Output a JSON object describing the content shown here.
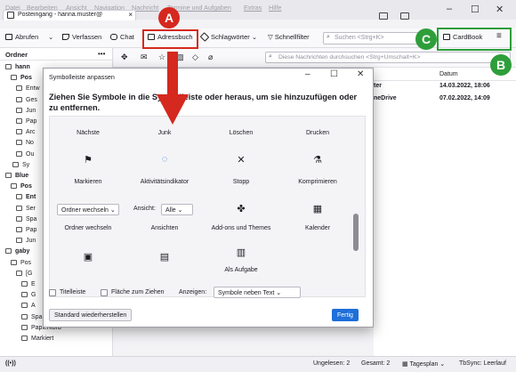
{
  "menu": [
    "Datei",
    "Bearbeiten",
    "Ansicht",
    "Navigation",
    "Nachricht",
    "Termine und Aufgaben",
    "Extras",
    "Hilfe"
  ],
  "tab": {
    "title": "Posteingang - hanna.muster@",
    "close": "×"
  },
  "window_controls": {
    "minimize": "–",
    "maximize": "☐",
    "close": "✕"
  },
  "toolbar": {
    "fetch": "Abrufen",
    "compose": "Verfassen",
    "chat": "Chat",
    "addressbook": "Adressbuch",
    "tags": "Schlagwörter",
    "quickfilter": "Schnellfilter",
    "search_placeholder": "Suchen <Strg+K>",
    "cardbook": "CardBook",
    "menu": "≡"
  },
  "folderpane": {
    "header": "Ordner",
    "more": "•••",
    "rows": [
      {
        "label": "hann",
        "bold": true
      },
      {
        "label": "Pos",
        "bold": true
      },
      {
        "label": "Entw",
        "bold": false
      },
      {
        "label": "Ges",
        "bold": false
      },
      {
        "label": "Jun",
        "bold": false
      },
      {
        "label": "Pap",
        "bold": false
      },
      {
        "label": "Arc",
        "bold": false
      },
      {
        "label": "No",
        "bold": false
      },
      {
        "label": "Ou",
        "bold": false
      },
      {
        "label": "Sy",
        "bold": false
      },
      {
        "label": "Blue",
        "bold": true
      },
      {
        "label": "Pos",
        "bold": true
      },
      {
        "label": "Ent",
        "bold": true
      },
      {
        "label": "Ser",
        "bold": false
      },
      {
        "label": "Spa",
        "bold": false
      },
      {
        "label": "Pap",
        "bold": false
      },
      {
        "label": "Jun",
        "bold": false
      },
      {
        "label": "gaby",
        "bold": true
      },
      {
        "label": "Pos",
        "bold": false
      },
      {
        "label": "[G",
        "bold": false
      },
      {
        "label": "E",
        "bold": false
      },
      {
        "label": "G",
        "bold": false
      },
      {
        "label": "A",
        "bold": false
      },
      {
        "label": "Spam",
        "bold": false
      },
      {
        "label": "Papierkorb",
        "bold": false
      },
      {
        "label": "Markiert",
        "bold": false
      }
    ]
  },
  "messagelist": {
    "filter_placeholder": "Diese Nachrichten durchsuchen <Strg+Umschalt+K>",
    "date_header": "Datum",
    "rows": [
      {
        "sender": "ter",
        "date": "14.03.2022, 18:06"
      },
      {
        "sender": "neDrive",
        "date": "07.02.2022, 14:09"
      }
    ]
  },
  "dialog": {
    "title": "Symbolleiste anpassen",
    "intro": "Ziehen Sie Symbole in die Symbolleiste oder heraus, um sie hinzuzufügen oder zu entfernen.",
    "row1": [
      "Nächste",
      "Junk",
      "Löschen",
      "Drucken"
    ],
    "row2": [
      {
        "label": "Markieren",
        "icon": "⚑"
      },
      {
        "label": "Aktivitätsindikator",
        "icon": "◌"
      },
      {
        "label": "Stopp",
        "icon": "✕"
      },
      {
        "label": "Komprimieren",
        "icon": "⚗"
      }
    ],
    "folder_switch": "Ordner wechseln",
    "view_label": "Ansicht:",
    "view_value": "Alle",
    "row3": [
      {
        "label": "Ordner wechseln",
        "icon": ""
      },
      {
        "label": "Ansichten",
        "icon": ""
      },
      {
        "label": "Add-ons und Themes",
        "icon": "✤"
      },
      {
        "label": "Kalender",
        "icon": "▦"
      }
    ],
    "row4": [
      {
        "label": "",
        "icon": "▣"
      },
      {
        "label": "",
        "icon": "▤"
      },
      {
        "label": "Als Aufgabe",
        "icon": "▥"
      }
    ],
    "titlebar_checkbox": "Titelleiste",
    "drag_space_checkbox": "Fläche zum Ziehen",
    "show_label": "Anzeigen:",
    "show_value": "Symbole neben Text",
    "restore_button": "Standard wiederherstellen",
    "done_button": "Fertig"
  },
  "statusbar": {
    "unread": "Ungelesen: 2",
    "total": "Gesamt: 2",
    "today_pane": "Tagesplan",
    "tbsync": "TbSync: Leerlauf"
  },
  "annotations": {
    "a": "A",
    "b": "B",
    "c": "C"
  },
  "colors": {
    "accent": "#1e6fd9",
    "callout_red": "#d5281e",
    "callout_green": "#2e9e3a"
  }
}
